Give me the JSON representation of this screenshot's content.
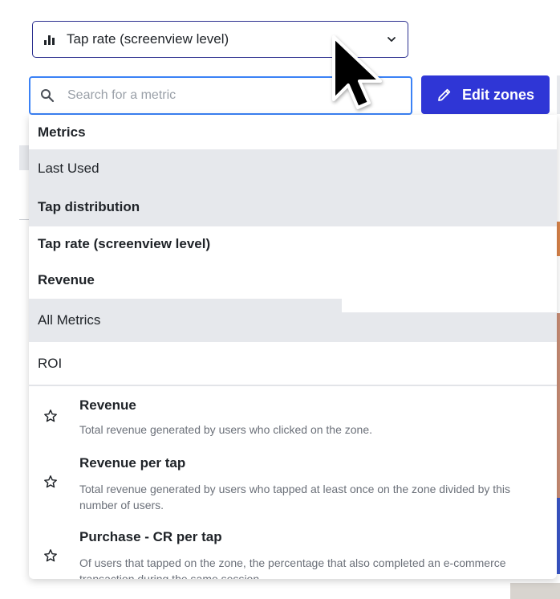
{
  "metric_selector": {
    "value": "Tap rate (screenview level)",
    "icon": "bar-chart-icon",
    "chevron": "chevron-down-icon"
  },
  "search": {
    "placeholder": "Search for a metric",
    "value": "",
    "icon": "search-icon"
  },
  "edit_zones": {
    "label": "Edit zones",
    "icon": "pencil-icon",
    "color": "#2f36d6"
  },
  "dropdown": {
    "metrics_header": "Metrics",
    "categories": [
      {
        "label": "Last Used"
      },
      {
        "label": "Tap distribution"
      },
      {
        "label": "Tap rate (screenview level)"
      },
      {
        "label": "Revenue"
      },
      {
        "label": "All Metrics"
      },
      {
        "label": "ROI"
      }
    ],
    "items": [
      {
        "title": "Revenue",
        "description": "Total revenue generated by users who clicked on the zone.",
        "icon": "star-outline-icon"
      },
      {
        "title": "Revenue per tap",
        "description": "Total revenue generated by users who tapped at least once on the zone divided by this number of users.",
        "icon": "star-outline-icon"
      },
      {
        "title": "Purchase - CR per tap",
        "description": "Of users that tapped on the zone, the percentage that also completed an e-commerce transaction during the same session.",
        "icon": "star-outline-icon"
      }
    ]
  },
  "colors": {
    "accent": "#2f36d6",
    "focus_border": "#3b82f6",
    "row_highlight": "#e6e8ec"
  }
}
